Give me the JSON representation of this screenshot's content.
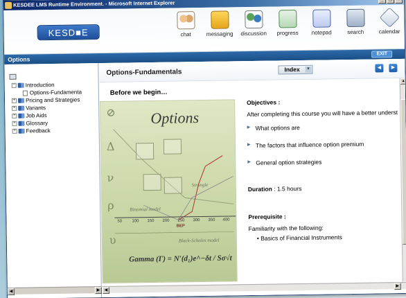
{
  "window": {
    "title": "KESDEE LMS Runtime Environment. - Microsoft Internet Explorer",
    "min": "_",
    "max": "□",
    "close": "×"
  },
  "header": {
    "logo": "KESD■E",
    "tools": [
      {
        "label": "chat",
        "icon": "chat-icon"
      },
      {
        "label": "messaging",
        "icon": "messaging-icon"
      },
      {
        "label": "discussion",
        "icon": "discussion-icon"
      },
      {
        "label": "progress",
        "icon": "progress-icon"
      },
      {
        "label": "notepad",
        "icon": "notepad-icon"
      },
      {
        "label": "search",
        "icon": "search-icon"
      },
      {
        "label": "calendar",
        "icon": "calendar-icon"
      }
    ]
  },
  "optbar": {
    "title": "Options",
    "exit": "EXIT"
  },
  "tree": {
    "items": [
      {
        "label": "Introduction"
      },
      {
        "label": "Options-Fundamenta"
      },
      {
        "label": "Pricing and Strategies"
      },
      {
        "label": "Variants"
      },
      {
        "label": "Job Aids"
      },
      {
        "label": "Glossary"
      },
      {
        "label": "Feedback"
      }
    ]
  },
  "main": {
    "title": "Options-Fundamentals",
    "index_label": "Index",
    "prev": "◀",
    "next": "▶",
    "subtitle": "Before we begin…",
    "graphic": {
      "heading": "Options",
      "strangle": "Strangle",
      "binomial": "Binomial model",
      "black_scholes": "Black-Scholes model",
      "formula": "Gamma (Γ)  =  N′(d₁)e^−δt / Sσ√t",
      "ticks": [
        "50",
        "100",
        "150",
        "200",
        "250",
        "300",
        "350",
        "400"
      ],
      "bep": "BEP"
    },
    "objectives_heading": "Objectives :",
    "objectives_intro": "After completing this course you will have a better underst",
    "objectives": [
      "What options are",
      "The factors that influence option premium",
      "General option strategies"
    ],
    "duration_label": "Duration",
    "duration_value": " : 1.5 hours",
    "prereq_heading": "Prerequisite :",
    "prereq_intro": "Familiarity with the following:",
    "prereq_item": "• Basics of Financial Instruments"
  }
}
